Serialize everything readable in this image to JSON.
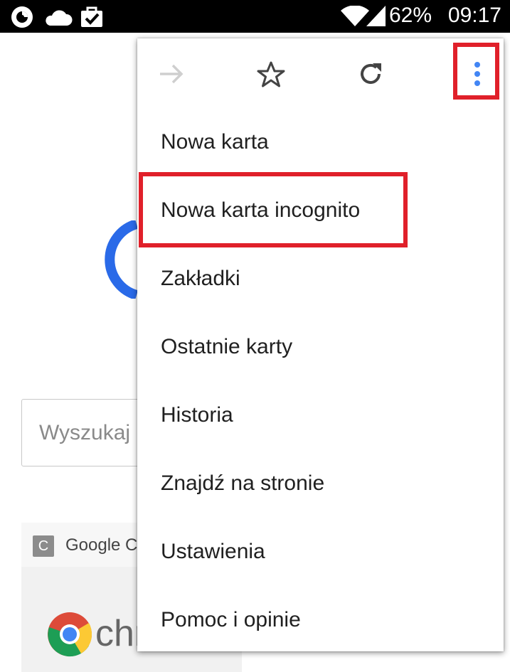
{
  "status_bar": {
    "battery": "62%",
    "clock": "09:17",
    "icons": [
      "firefox-icon",
      "cloud-icon",
      "bag-check-icon",
      "wifi-icon",
      "signal-icon",
      "battery-icon"
    ]
  },
  "page": {
    "search_placeholder": "Wyszukaj",
    "tile": {
      "favicon_letter": "C",
      "title": "Google C",
      "logo_text": "chr"
    }
  },
  "menu": {
    "toolbar": [
      "forward-icon",
      "star-icon",
      "reload-icon",
      "more-vert-icon"
    ],
    "items": [
      {
        "label": "Nowa karta"
      },
      {
        "label": "Nowa karta incognito"
      },
      {
        "label": "Zakładki"
      },
      {
        "label": "Ostatnie karty"
      },
      {
        "label": "Historia"
      },
      {
        "label": "Znajdź na stronie"
      },
      {
        "label": "Ustawienia"
      },
      {
        "label": "Pomoc i opinie"
      }
    ]
  },
  "colors": {
    "highlight": "#e0202a",
    "more_dots": "#4285f4",
    "google_blue": "#2a6ae8"
  }
}
